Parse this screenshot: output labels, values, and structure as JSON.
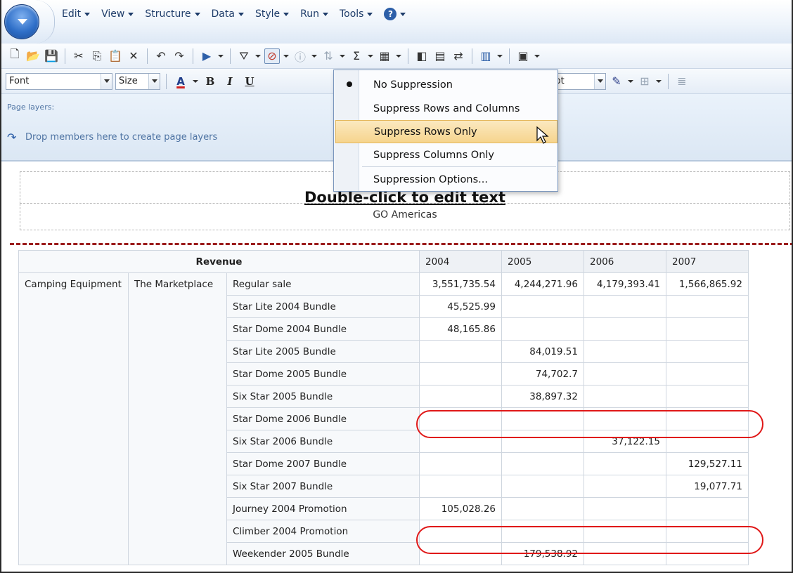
{
  "menus": [
    {
      "label": "Edit"
    },
    {
      "label": "View"
    },
    {
      "label": "Structure"
    },
    {
      "label": "Data"
    },
    {
      "label": "Style"
    },
    {
      "label": "Run"
    },
    {
      "label": "Tools"
    }
  ],
  "help_label": "?",
  "format": {
    "font_placeholder": "Font",
    "size_placeholder": "Size",
    "font_color_glyph": "A",
    "bold_glyph": "B",
    "italic_glyph": "I",
    "underline_glyph": "U",
    "border_width": "1 pt"
  },
  "page_layers": {
    "title": "Page layers:",
    "hint": "Drop members here to create page layers"
  },
  "suppression_menu": {
    "items": [
      {
        "label": "No Suppression",
        "selected": true
      },
      {
        "label": "Suppress Rows and Columns",
        "selected": false
      },
      {
        "label": "Suppress Rows Only",
        "selected": false,
        "hovered": true
      },
      {
        "label": "Suppress Columns Only",
        "selected": false
      },
      {
        "label": "Suppression Options...",
        "selected": false
      }
    ]
  },
  "report": {
    "title": "Double-click to edit text",
    "subtitle": "GO Americas",
    "measure": "Revenue",
    "years": [
      "2004",
      "2005",
      "2006",
      "2007"
    ],
    "product_line": "Camping Equipment",
    "retailer": "The Marketplace",
    "rows": [
      {
        "label": "Regular sale",
        "values": [
          "3,551,735.54",
          "4,244,271.96",
          "4,179,393.41",
          "1,566,865.92"
        ]
      },
      {
        "label": "Star Lite 2004 Bundle",
        "values": [
          "45,525.99",
          "",
          "",
          ""
        ]
      },
      {
        "label": "Star Dome 2004 Bundle",
        "values": [
          "48,165.86",
          "",
          "",
          ""
        ]
      },
      {
        "label": "Star Lite 2005 Bundle",
        "values": [
          "",
          "84,019.51",
          "",
          ""
        ]
      },
      {
        "label": "Star Dome 2005 Bundle",
        "values": [
          "",
          "74,702.7",
          "",
          ""
        ]
      },
      {
        "label": "Six Star 2005 Bundle",
        "values": [
          "",
          "38,897.32",
          "",
          ""
        ]
      },
      {
        "label": "Star Dome 2006 Bundle",
        "values": [
          "",
          "",
          "",
          ""
        ]
      },
      {
        "label": "Six Star 2006 Bundle",
        "values": [
          "",
          "",
          "37,122.15",
          ""
        ]
      },
      {
        "label": "Star Dome 2007 Bundle",
        "values": [
          "",
          "",
          "",
          "129,527.11"
        ]
      },
      {
        "label": "Six Star 2007 Bundle",
        "values": [
          "",
          "",
          "",
          "19,077.71"
        ]
      },
      {
        "label": "Journey 2004 Promotion",
        "values": [
          "105,028.26",
          "",
          "",
          ""
        ]
      },
      {
        "label": "Climber 2004 Promotion",
        "values": [
          "",
          "",
          "",
          ""
        ]
      },
      {
        "label": "Weekender 2005 Bundle",
        "values": [
          "",
          "179,538.92",
          "",
          ""
        ]
      }
    ]
  },
  "colors": {
    "highlight": "#e01818",
    "page_break": "#9b1c1c",
    "menu_hover": "#f6d48d"
  }
}
